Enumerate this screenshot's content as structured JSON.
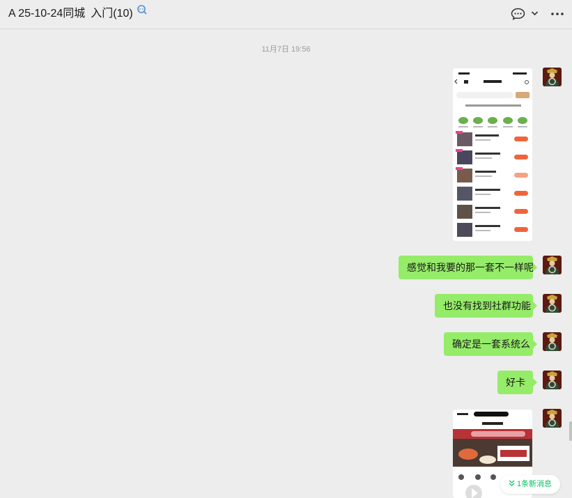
{
  "header": {
    "title": "A 25-10-24同城",
    "subtitle": "入门(10)"
  },
  "timestamp": "11月7日 19:56",
  "messages": [
    "感觉和我要的那一套不一样呢",
    "也没有找到社群功能",
    "确定是一套系统么",
    "好卡"
  ],
  "new_message_notice": "1条新消息",
  "colors": {
    "bubble": "#95ec69",
    "accent": "#07c160",
    "background": "#ededed"
  },
  "icons": [
    "robot-icon",
    "chat-bubble-icon",
    "chevron-down-icon",
    "more-icon",
    "avatar"
  ]
}
